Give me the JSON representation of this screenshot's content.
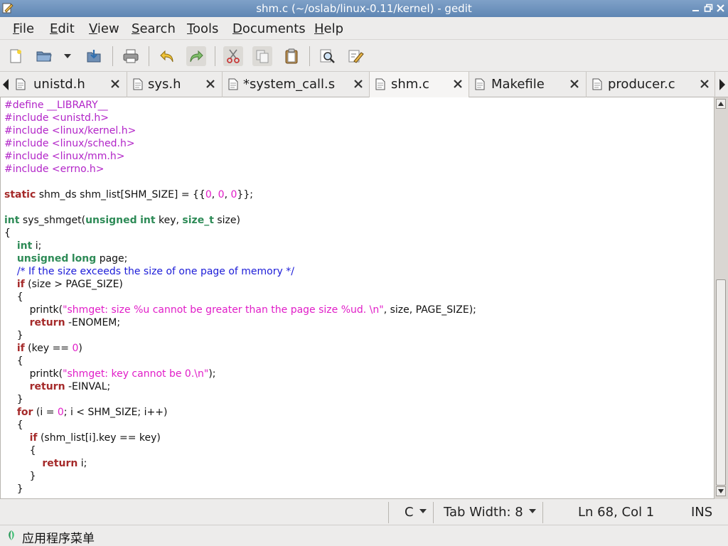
{
  "window": {
    "title": "shm.c (~/oslab/linux-0.11/kernel) - gedit"
  },
  "menu": [
    {
      "pre": "",
      "ul": "F",
      "post": "ile"
    },
    {
      "pre": "",
      "ul": "E",
      "post": "dit"
    },
    {
      "pre": "",
      "ul": "V",
      "post": "iew"
    },
    {
      "pre": "",
      "ul": "S",
      "post": "earch"
    },
    {
      "pre": "",
      "ul": "T",
      "post": "ools"
    },
    {
      "pre": "",
      "ul": "D",
      "post": "ocuments"
    },
    {
      "pre": "",
      "ul": "H",
      "post": "elp"
    }
  ],
  "toolbar": {
    "icons": [
      "new-document-icon",
      "open-icon",
      "open-dropdown-icon",
      "save-icon",
      "print-icon",
      "undo-icon",
      "redo-icon",
      "cut-icon",
      "copy-icon",
      "paste-icon",
      "find-icon",
      "find-replace-icon"
    ]
  },
  "tabs": [
    {
      "label": "unistd.h",
      "active": false
    },
    {
      "label": "sys.h",
      "active": false
    },
    {
      "label": "*system_call.s",
      "active": false
    },
    {
      "label": "shm.c",
      "active": true
    },
    {
      "label": "Makefile",
      "active": false
    },
    {
      "label": "producer.c",
      "active": false
    }
  ],
  "code_lines": [
    "#define __LIBRARY__",
    "#include <unistd.h>",
    "#include <linux/kernel.h>",
    "#include <linux/sched.h>",
    "#include <linux/mm.h>",
    "#include <errno.h>",
    "",
    "static shm_ds shm_list[SHM_SIZE] = {{0, 0, 0}};",
    "",
    "int sys_shmget(unsigned int key, size_t size)",
    "{",
    "    int i;",
    "    unsigned long page;",
    "    /* If the size exceeds the size of one page of memory */",
    "    if (size > PAGE_SIZE)",
    "    {",
    "        printk(\"shmget: size %u cannot be greater than the page size %ud. \\n\", size, PAGE_SIZE);",
    "        return -ENOMEM;",
    "    }",
    "    if (key == 0)",
    "    {",
    "        printk(\"shmget: key cannot be 0.\\n\");",
    "        return -EINVAL;",
    "    }",
    "    for (i = 0; i < SHM_SIZE; i++)",
    "    {",
    "        if (shm_list[i].key == key)",
    "        {",
    "            return i;",
    "        }",
    "    }"
  ],
  "status": {
    "language": "C",
    "tab_width": "Tab Width:  8",
    "position": "Ln 68, Col 1",
    "mode": "INS"
  },
  "taskbar": {
    "label": "应用程序菜单"
  },
  "colors": {
    "preprocessor": "#b224c8",
    "type": "#2e8b57",
    "statement": "#a52a2a",
    "string_number": "#e11ec8",
    "comment": "#1c1cd8"
  }
}
